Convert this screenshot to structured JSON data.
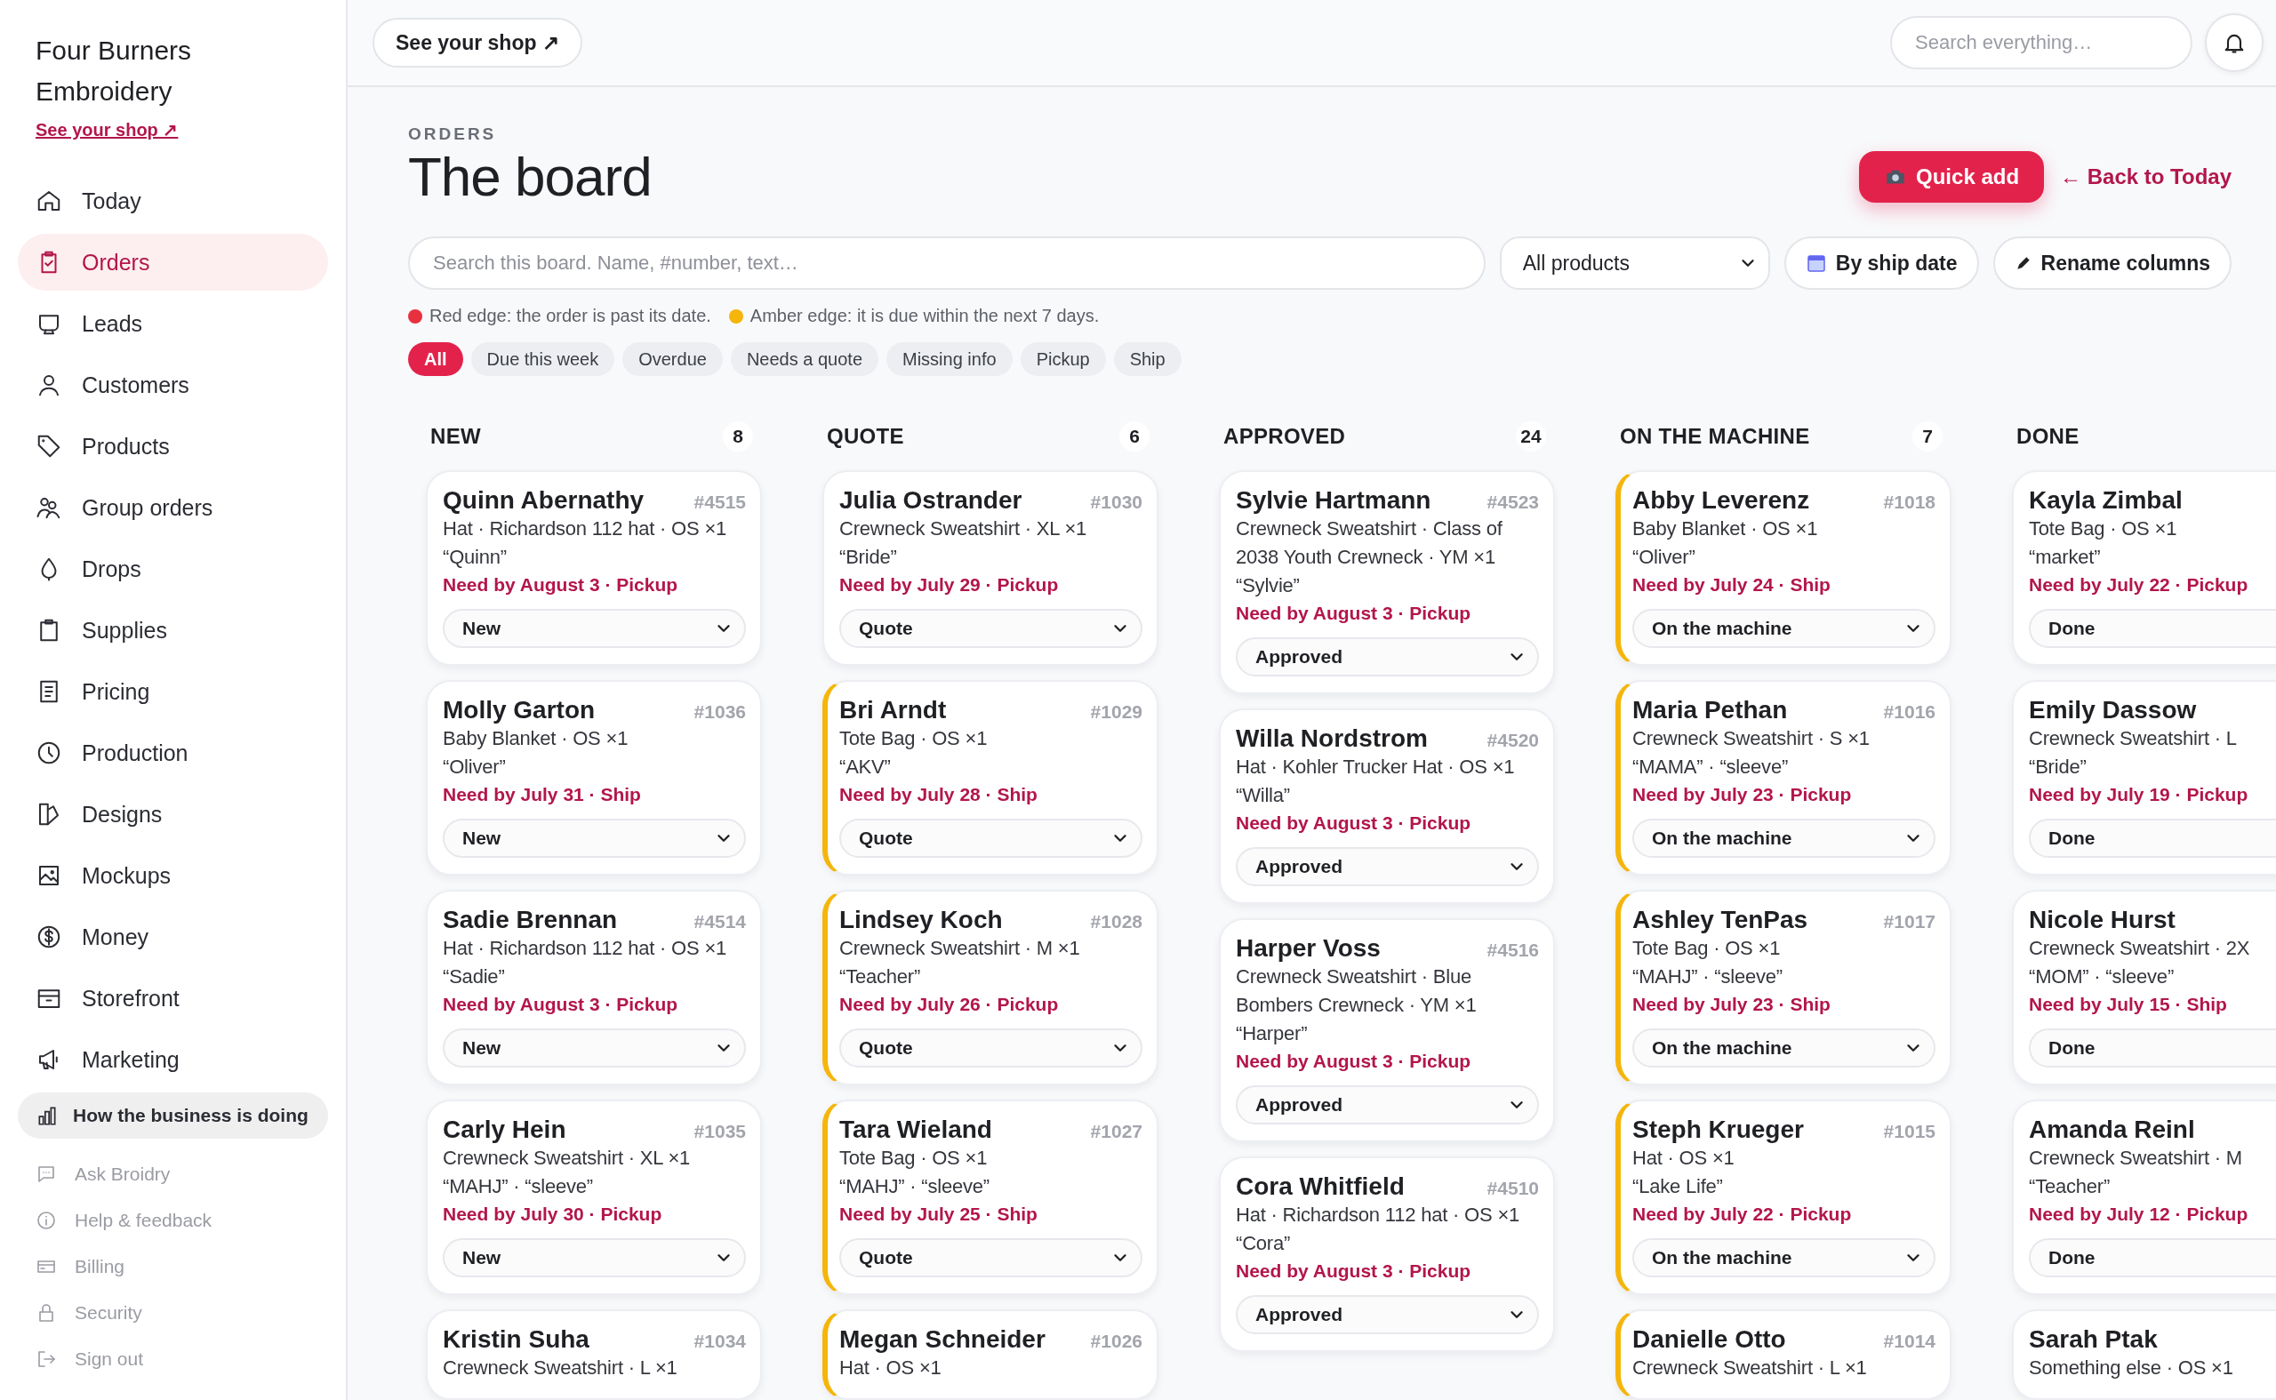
{
  "sidebar": {
    "brand": "Four Burners Embroidery",
    "shop_link": "See your shop ↗",
    "nav_items": [
      {
        "label": "Today",
        "selected": false
      },
      {
        "label": "Orders",
        "selected": true
      },
      {
        "label": "Leads",
        "selected": false
      },
      {
        "label": "Customers",
        "selected": false
      },
      {
        "label": "Products",
        "selected": false
      },
      {
        "label": "Group orders",
        "selected": false
      },
      {
        "label": "Drops",
        "selected": false
      },
      {
        "label": "Supplies",
        "selected": false
      },
      {
        "label": "Pricing",
        "selected": false
      },
      {
        "label": "Production",
        "selected": false
      },
      {
        "label": "Designs",
        "selected": false
      },
      {
        "label": "Mockups",
        "selected": false
      },
      {
        "label": "Money",
        "selected": false
      },
      {
        "label": "Storefront",
        "selected": false
      },
      {
        "label": "Marketing",
        "selected": false
      }
    ],
    "insights_item": "How the business is doing",
    "footer_items": [
      "Ask Broidry",
      "Help & feedback",
      "Billing",
      "Security",
      "Sign out"
    ]
  },
  "topbar": {
    "shop_button": "See your shop ↗",
    "search": {
      "placeholder": "Search everything…"
    }
  },
  "page": {
    "eyebrow": "ORDERS",
    "title": "The board",
    "quick_add": "Quick add",
    "back_link": "← Back to Today",
    "board_search": {
      "placeholder": "Search this board. Name, #number, text…"
    },
    "product_filter": "All products",
    "sort_button": "By ship date",
    "rename_button": "Rename columns",
    "legend": [
      {
        "color": "#e8313f",
        "text": "Red edge: the order is past its date."
      },
      {
        "color": "#f5b50a",
        "text": "Amber edge: it is due within the next 7 days."
      }
    ],
    "chips": [
      {
        "label": "All",
        "selected": true
      },
      {
        "label": "Due this week",
        "selected": false
      },
      {
        "label": "Overdue",
        "selected": false
      },
      {
        "label": "Needs a quote",
        "selected": false
      },
      {
        "label": "Missing info",
        "selected": false
      },
      {
        "label": "Pickup",
        "selected": false
      },
      {
        "label": "Ship",
        "selected": false
      }
    ]
  },
  "columns": [
    {
      "title": "NEW",
      "count": "8",
      "cards": [
        {
          "name": "Quinn Abernathy",
          "number": "#4515",
          "product": "Hat · Richardson 112 hat · OS ×1",
          "note": "“Quinn”",
          "due": "Need by August 3 · Pickup",
          "due_soon": false,
          "status": "New"
        },
        {
          "name": "Molly Garton",
          "number": "#1036",
          "product": "Baby Blanket · OS ×1",
          "note": "“Oliver”",
          "due": "Need by July 31 · Ship",
          "due_soon": false,
          "status": "New"
        },
        {
          "name": "Sadie Brennan",
          "number": "#4514",
          "product": "Hat · Richardson 112 hat · OS ×1",
          "note": "“Sadie”",
          "due": "Need by August 3 · Pickup",
          "due_soon": false,
          "status": "New"
        },
        {
          "name": "Carly Hein",
          "number": "#1035",
          "product": "Crewneck Sweatshirt · XL ×1",
          "note": "“MAHJ” · “sleeve”",
          "due": "Need by July 30 · Pickup",
          "due_soon": false,
          "status": "New"
        },
        {
          "name": "Kristin Suha",
          "number": "#1034",
          "product": "Crewneck Sweatshirt · L ×1",
          "due_soon": false
        }
      ]
    },
    {
      "title": "QUOTE",
      "count": "6",
      "cards": [
        {
          "name": "Julia Ostrander",
          "number": "#1030",
          "product": "Crewneck Sweatshirt · XL ×1",
          "note": "“Bride”",
          "due": "Need by July 29 · Pickup",
          "due_soon": false,
          "status": "Quote"
        },
        {
          "name": "Bri Arndt",
          "number": "#1029",
          "product": "Tote Bag · OS ×1",
          "note": "“AKV”",
          "due": "Need by July 28 · Ship",
          "due_soon": true,
          "status": "Quote"
        },
        {
          "name": "Lindsey Koch",
          "number": "#1028",
          "product": "Crewneck Sweatshirt · M ×1",
          "note": "“Teacher”",
          "due": "Need by July 26 · Pickup",
          "due_soon": true,
          "status": "Quote"
        },
        {
          "name": "Tara Wieland",
          "number": "#1027",
          "product": "Tote Bag · OS ×1",
          "note": "“MAHJ” · “sleeve”",
          "due": "Need by July 25 · Ship",
          "due_soon": true,
          "status": "Quote"
        },
        {
          "name": "Megan Schneider",
          "number": "#1026",
          "product": "Hat · OS ×1",
          "due_soon": true
        }
      ]
    },
    {
      "title": "APPROVED",
      "count": "24",
      "cards": [
        {
          "name": "Sylvie Hartmann",
          "number": "#4523",
          "product": "Crewneck Sweatshirt · Class of 2038 Youth Crewneck · YM ×1",
          "note": "“Sylvie”",
          "due": "Need by August 3 · Pickup",
          "due_soon": false,
          "status": "Approved"
        },
        {
          "name": "Willa Nordstrom",
          "number": "#4520",
          "product": "Hat · Kohler Trucker Hat · OS ×1",
          "note": "“Willa”",
          "due": "Need by August 3 · Pickup",
          "due_soon": false,
          "status": "Approved"
        },
        {
          "name": "Harper Voss",
          "number": "#4516",
          "product": "Crewneck Sweatshirt · Blue Bombers Crewneck · YM ×1",
          "note": "“Harper”",
          "due": "Need by August 3 · Pickup",
          "due_soon": false,
          "status": "Approved"
        },
        {
          "name": "Cora Whitfield",
          "number": "#4510",
          "product": "Hat · Richardson 112 hat · OS ×1",
          "note": "“Cora”",
          "due": "Need by August 3 · Pickup",
          "due_soon": false,
          "status": "Approved"
        }
      ]
    },
    {
      "title": "ON THE MACHINE",
      "count": "7",
      "cards": [
        {
          "name": "Abby Leverenz",
          "number": "#1018",
          "product": "Baby Blanket · OS ×1",
          "note": "“Oliver”",
          "due": "Need by July 24 · Ship",
          "due_soon": true,
          "status": "On the machine"
        },
        {
          "name": "Maria Pethan",
          "number": "#1016",
          "product": "Crewneck Sweatshirt · S ×1",
          "note": "“MAMA” · “sleeve”",
          "due": "Need by July 23 · Pickup",
          "due_soon": true,
          "status": "On the machine"
        },
        {
          "name": "Ashley TenPas",
          "number": "#1017",
          "product": "Tote Bag · OS ×1",
          "note": "“MAHJ” · “sleeve”",
          "due": "Need by July 23 · Ship",
          "due_soon": true,
          "status": "On the machine"
        },
        {
          "name": "Steph Krueger",
          "number": "#1015",
          "product": "Hat · OS ×1",
          "note": "“Lake Life”",
          "due": "Need by July 22 · Pickup",
          "due_soon": true,
          "status": "On the machine"
        },
        {
          "name": "Danielle Otto",
          "number": "#1014",
          "product": "Crewneck Sweatshirt · L ×1",
          "due_soon": true
        }
      ]
    },
    {
      "title": "DONE",
      "cards": [
        {
          "name": "Kayla Zimbal",
          "product": "Tote Bag · OS ×1",
          "note": "“market”",
          "due": "Need by July 22 · Pickup",
          "due_soon": false,
          "status": "Done"
        },
        {
          "name": "Emily Dassow",
          "product": "Crewneck Sweatshirt · L",
          "note": "“Bride”",
          "due": "Need by July 19 · Pickup",
          "due_soon": false,
          "status": "Done"
        },
        {
          "name": "Nicole Hurst",
          "product": "Crewneck Sweatshirt · 2X",
          "note": "“MOM” · “sleeve”",
          "due": "Need by July 15 · Ship",
          "due_soon": false,
          "status": "Done"
        },
        {
          "name": "Amanda Reinl",
          "product": "Crewneck Sweatshirt · M",
          "note": "“Teacher”",
          "due": "Need by July 12 · Pickup",
          "due_soon": false,
          "status": "Done"
        },
        {
          "name": "Sarah Ptak",
          "product": "Something else · OS ×1",
          "due_soon": false
        }
      ]
    }
  ]
}
